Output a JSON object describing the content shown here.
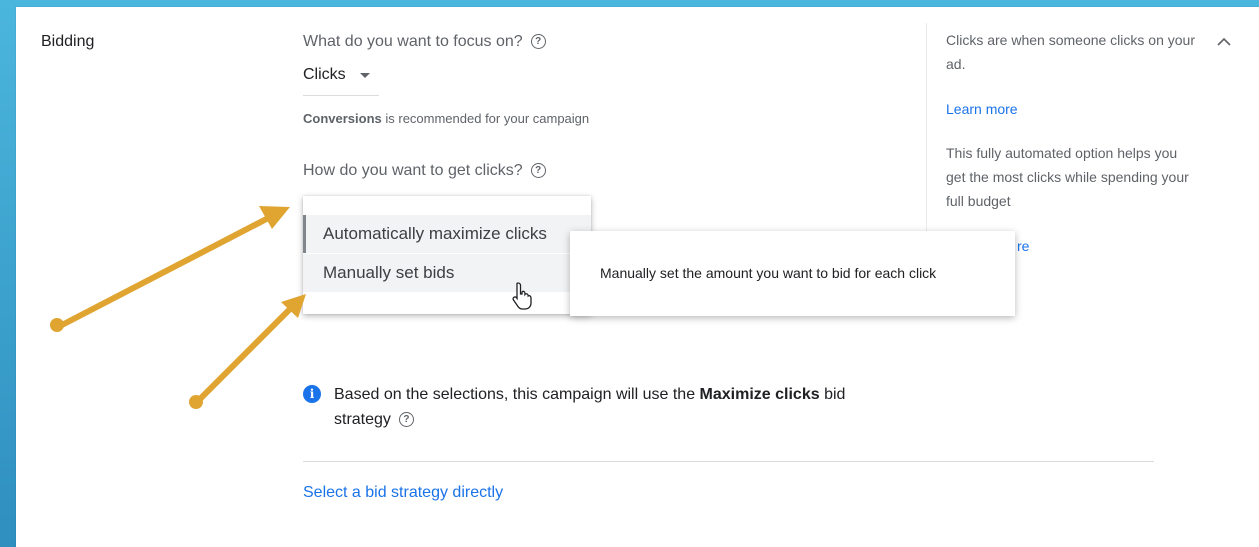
{
  "bidding": {
    "section_title": "Bidding",
    "focus_question": "What do you want to focus on?",
    "focus_value": "Clicks",
    "recommend_bold": "Conversions",
    "recommend_rest": " is recommended for your campaign",
    "clicks_question": "How do you want to get clicks?",
    "options": [
      {
        "label": "Automatically maximize clicks"
      },
      {
        "label": "Manually set bids"
      }
    ],
    "tooltip": "Manually set the amount you want to bid for each click",
    "info_prefix": "Based on the selections, this campaign will use the ",
    "info_bold": "Maximize clicks",
    "info_suffix": " bid",
    "info_line2": "strategy",
    "select_link": "Select a bid strategy directly"
  },
  "side": {
    "text1": "Clicks are when someone clicks on your ad.",
    "learn_more_1": "Learn more",
    "text2": "This fully automated option helps you get the most clicks while spending your full budget",
    "learn_more_2_visible": "re"
  },
  "icons": {
    "help": "help-circle-icon",
    "info": "info-icon",
    "collapse": "chevron-up-icon",
    "caret": "caret-down-icon",
    "cursor": "hand-pointer-icon"
  },
  "colors": {
    "link": "#1a73e8",
    "annotation_arrow": "#e0a431",
    "info": "#1a73e8"
  }
}
